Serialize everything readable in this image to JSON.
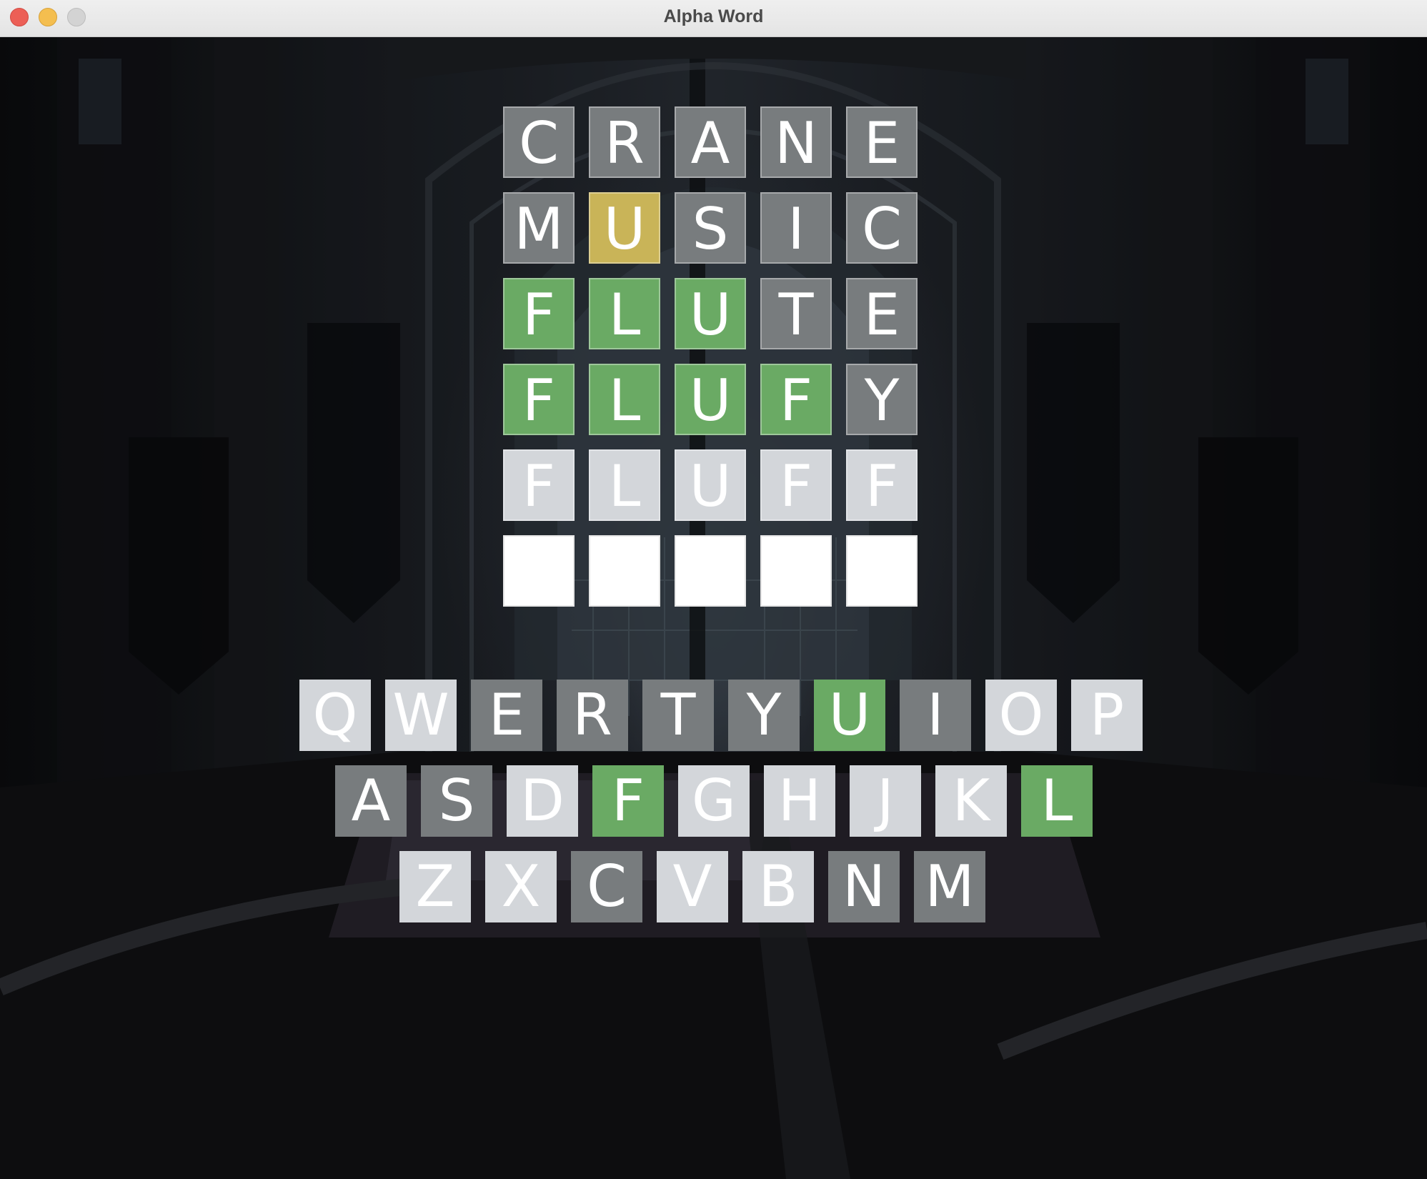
{
  "window": {
    "title": "Alpha Word"
  },
  "colors": {
    "absent": "#787c7e",
    "present": "#c9b458",
    "correct": "#6aaa64",
    "pending": "#d3d6da",
    "empty": "#ffffff"
  },
  "board": {
    "rows": [
      {
        "tiles": [
          {
            "letter": "C",
            "state": "absent"
          },
          {
            "letter": "R",
            "state": "absent"
          },
          {
            "letter": "A",
            "state": "absent"
          },
          {
            "letter": "N",
            "state": "absent"
          },
          {
            "letter": "E",
            "state": "absent"
          }
        ]
      },
      {
        "tiles": [
          {
            "letter": "M",
            "state": "absent"
          },
          {
            "letter": "U",
            "state": "present"
          },
          {
            "letter": "S",
            "state": "absent"
          },
          {
            "letter": "I",
            "state": "absent"
          },
          {
            "letter": "C",
            "state": "absent"
          }
        ]
      },
      {
        "tiles": [
          {
            "letter": "F",
            "state": "correct"
          },
          {
            "letter": "L",
            "state": "correct"
          },
          {
            "letter": "U",
            "state": "correct"
          },
          {
            "letter": "T",
            "state": "absent"
          },
          {
            "letter": "E",
            "state": "absent"
          }
        ]
      },
      {
        "tiles": [
          {
            "letter": "F",
            "state": "correct"
          },
          {
            "letter": "L",
            "state": "correct"
          },
          {
            "letter": "U",
            "state": "correct"
          },
          {
            "letter": "F",
            "state": "correct"
          },
          {
            "letter": "Y",
            "state": "absent"
          }
        ]
      },
      {
        "tiles": [
          {
            "letter": "F",
            "state": "pending"
          },
          {
            "letter": "L",
            "state": "pending"
          },
          {
            "letter": "U",
            "state": "pending"
          },
          {
            "letter": "F",
            "state": "pending"
          },
          {
            "letter": "F",
            "state": "pending"
          }
        ]
      },
      {
        "tiles": [
          {
            "letter": "",
            "state": "empty"
          },
          {
            "letter": "",
            "state": "empty"
          },
          {
            "letter": "",
            "state": "empty"
          },
          {
            "letter": "",
            "state": "empty"
          },
          {
            "letter": "",
            "state": "empty"
          }
        ]
      }
    ]
  },
  "keyboard": {
    "rows": [
      {
        "keys": [
          {
            "letter": "Q",
            "state": "unused"
          },
          {
            "letter": "W",
            "state": "unused"
          },
          {
            "letter": "E",
            "state": "absent"
          },
          {
            "letter": "R",
            "state": "absent"
          },
          {
            "letter": "T",
            "state": "absent"
          },
          {
            "letter": "Y",
            "state": "absent"
          },
          {
            "letter": "U",
            "state": "correct"
          },
          {
            "letter": "I",
            "state": "absent"
          },
          {
            "letter": "O",
            "state": "unused"
          },
          {
            "letter": "P",
            "state": "unused"
          }
        ]
      },
      {
        "keys": [
          {
            "letter": "A",
            "state": "absent"
          },
          {
            "letter": "S",
            "state": "absent"
          },
          {
            "letter": "D",
            "state": "unused"
          },
          {
            "letter": "F",
            "state": "correct"
          },
          {
            "letter": "G",
            "state": "unused"
          },
          {
            "letter": "H",
            "state": "unused"
          },
          {
            "letter": "J",
            "state": "unused"
          },
          {
            "letter": "K",
            "state": "unused"
          },
          {
            "letter": "L",
            "state": "correct"
          }
        ]
      },
      {
        "keys": [
          {
            "letter": "Z",
            "state": "unused"
          },
          {
            "letter": "X",
            "state": "unused"
          },
          {
            "letter": "C",
            "state": "absent"
          },
          {
            "letter": "V",
            "state": "unused"
          },
          {
            "letter": "B",
            "state": "unused"
          },
          {
            "letter": "N",
            "state": "absent"
          },
          {
            "letter": "M",
            "state": "absent"
          }
        ]
      }
    ]
  }
}
